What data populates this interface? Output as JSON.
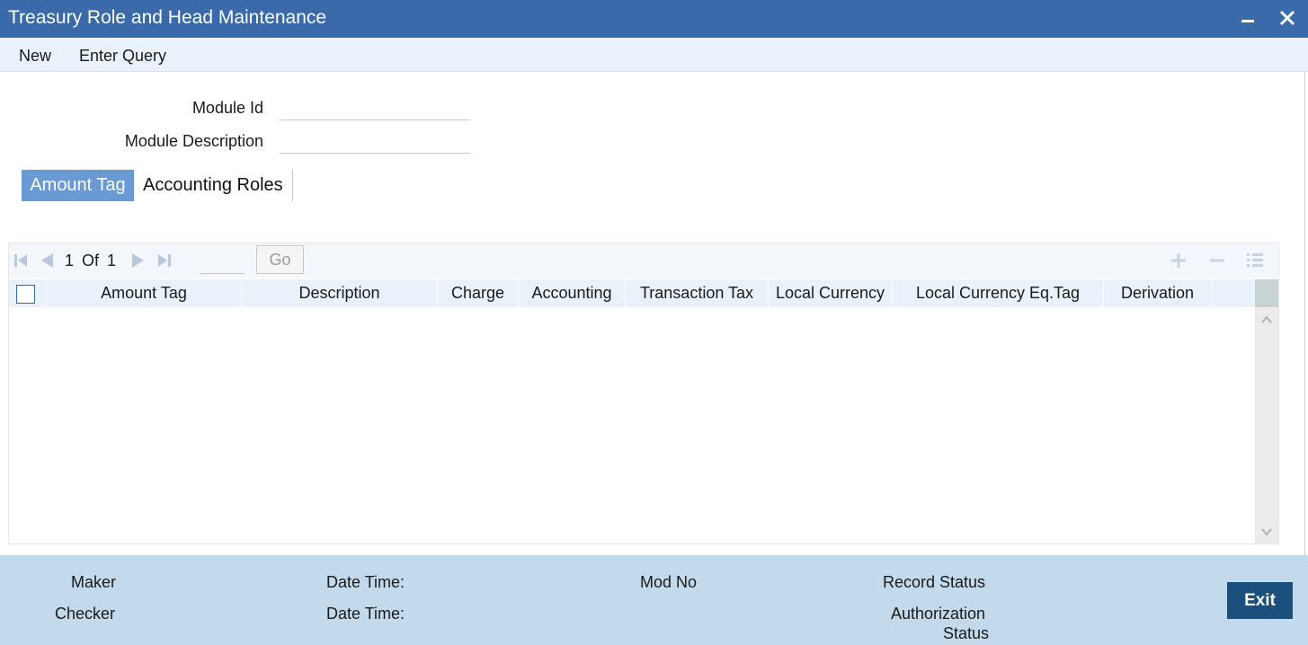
{
  "window": {
    "title": "Treasury Role and Head Maintenance"
  },
  "menu": {
    "new_label": "New",
    "enter_query_label": "Enter Query"
  },
  "form": {
    "module_id_label": "Module Id",
    "module_id_value": "",
    "module_description_label": "Module Description",
    "module_description_value": ""
  },
  "tabs": [
    {
      "label": "Amount Tag",
      "active": true
    },
    {
      "label": "Accounting Roles",
      "active": false
    }
  ],
  "grid": {
    "pager": {
      "current": "1",
      "of_label": "Of",
      "total": "1",
      "go_label": "Go",
      "page_input": ""
    },
    "columns": [
      "Amount Tag",
      "Description",
      "Charge",
      "Accounting",
      "Transaction Tax",
      "Local Currency",
      "Local Currency Eq.Tag",
      "Derivation"
    ],
    "rows": []
  },
  "footer": {
    "maker_label": "Maker",
    "checker_label": "Checker",
    "date_time_label_1": "Date Time:",
    "date_time_label_2": "Date Time:",
    "mod_no_label": "Mod No",
    "record_status_label": "Record Status",
    "authorization_label": "Authorization",
    "status_label": "Status",
    "exit_label": "Exit"
  },
  "colors": {
    "titlebar": "#3a6aa9",
    "active_tab": "#6a9ad4",
    "footer": "#c3d9ec",
    "exit_button": "#1b4f7e"
  }
}
